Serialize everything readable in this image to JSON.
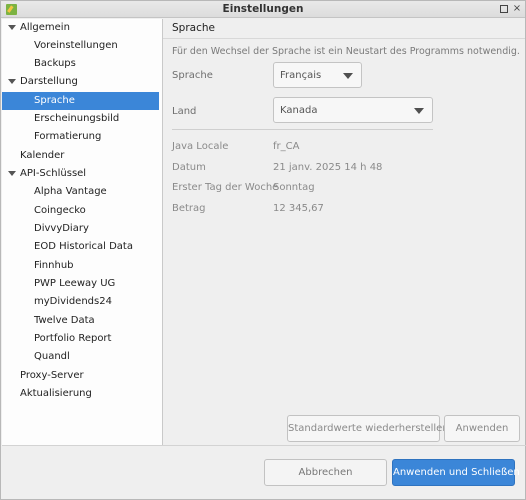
{
  "window": {
    "title": "Einstellungen",
    "icon": "app-pencil-icon",
    "controls": {
      "maximize": "maximize-icon",
      "close": "×"
    }
  },
  "sidebar": {
    "items": [
      {
        "label": "Allgemein",
        "level": 0,
        "expanded": true
      },
      {
        "label": "Voreinstellungen",
        "level": 1
      },
      {
        "label": "Backups",
        "level": 1
      },
      {
        "label": "Darstellung",
        "level": 0,
        "expanded": true
      },
      {
        "label": "Sprache",
        "level": 1,
        "selected": true
      },
      {
        "label": "Erscheinungsbild",
        "level": 1
      },
      {
        "label": "Formatierung",
        "level": 1
      },
      {
        "label": "Kalender",
        "level": 0
      },
      {
        "label": "API-Schlüssel",
        "level": 0,
        "expanded": true
      },
      {
        "label": "Alpha Vantage",
        "level": 1
      },
      {
        "label": "Coingecko",
        "level": 1
      },
      {
        "label": "DivvyDiary",
        "level": 1
      },
      {
        "label": "EOD Historical Data",
        "level": 1
      },
      {
        "label": "Finnhub",
        "level": 1
      },
      {
        "label": "PWP Leeway UG",
        "level": 1
      },
      {
        "label": "myDividends24",
        "level": 1
      },
      {
        "label": "Twelve Data",
        "level": 1
      },
      {
        "label": "Portfolio Report",
        "level": 1
      },
      {
        "label": "Quandl",
        "level": 1
      },
      {
        "label": "Proxy-Server",
        "level": 0
      },
      {
        "label": "Aktualisierung",
        "level": 0
      }
    ]
  },
  "content": {
    "header": "Sprache",
    "note": "Für den Wechsel der Sprache ist ein Neustart des Programms notwendig.",
    "language": {
      "label": "Sprache",
      "value": "Français"
    },
    "country": {
      "label": "Land",
      "value": "Kanada"
    },
    "info": [
      {
        "label": "Java Locale",
        "value": "fr_CA"
      },
      {
        "label": "Datum",
        "value": "21 janv. 2025 14 h 48"
      },
      {
        "label": "Erster Tag der Woche",
        "value": "Sonntag"
      },
      {
        "label": "Betrag",
        "value": "12 345,67"
      }
    ],
    "buttons": {
      "restore_defaults": "Standardwerte wiederherstellen",
      "apply": "Anwenden"
    }
  },
  "footer": {
    "cancel": "Abbrechen",
    "apply_close": "Anwenden und Schließen"
  },
  "colors": {
    "accent": "#3b86d8"
  }
}
